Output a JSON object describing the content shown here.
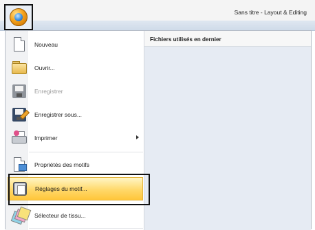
{
  "window": {
    "title": "Sans titre - Layout & Editing"
  },
  "app_button": {
    "icon": "app-menu-icon"
  },
  "menu": {
    "items": [
      {
        "label": "Nouveau",
        "icon": "new-document-icon",
        "enabled": true
      },
      {
        "label": "Ouvrir...",
        "icon": "open-folder-icon",
        "enabled": true
      },
      {
        "label": "Enregistrer",
        "icon": "save-icon",
        "enabled": false
      },
      {
        "label": "Enregistrer sous...",
        "icon": "save-as-icon",
        "enabled": true
      },
      {
        "label": "Imprimer",
        "icon": "printer-icon",
        "enabled": true,
        "submenu": true
      },
      {
        "label": "Propriétés des motifs",
        "icon": "design-properties-icon",
        "enabled": true
      },
      {
        "label": "Réglages du motif...",
        "icon": "design-settings-icon",
        "enabled": true,
        "highlighted": true
      },
      {
        "label": "Sélecteur de tissu...",
        "icon": "fabric-selector-icon",
        "enabled": true
      }
    ]
  },
  "recent": {
    "header": "Fichiers utilisés en dernier"
  },
  "colors": {
    "highlight": "#ffd86a",
    "callout_border": "#111111",
    "panel_bg": "#e6ebf3"
  }
}
